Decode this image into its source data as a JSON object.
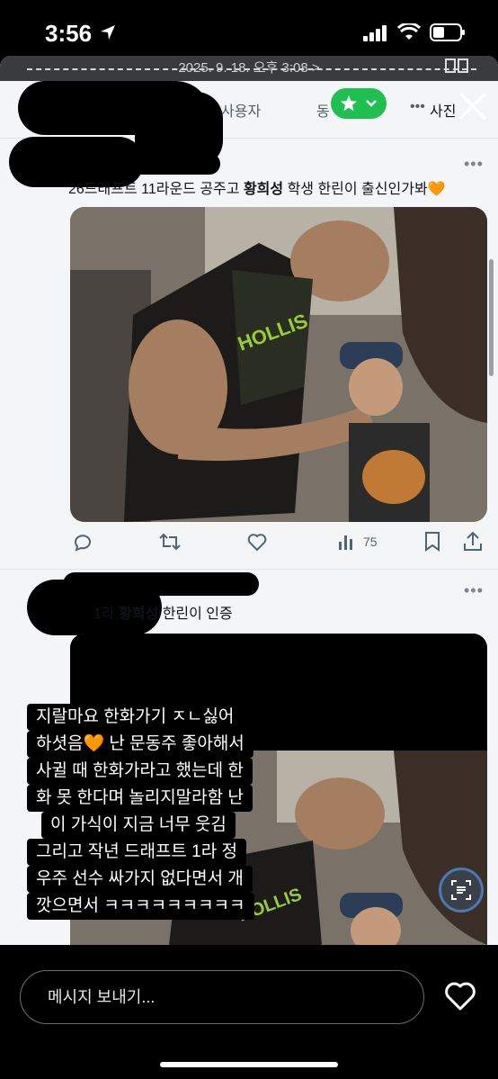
{
  "status_bar": {
    "time": "3:56"
  },
  "story": {
    "date": "2025. 9. 18. 오후 3:08",
    "date_suffix": ">"
  },
  "tabs": [
    {
      "label": "사용자"
    },
    {
      "label": "동"
    },
    {
      "label": "사진"
    }
  ],
  "tweets": [
    {
      "text_prefix": "26드래프트 11라운드 공주고 ",
      "text_bold": "황희성",
      "text_suffix": " 학생 한린이 출신인가봐🧡",
      "more": "•••",
      "views": "75"
    },
    {
      "text_prefix": "1라 ",
      "text_bold": "황희성",
      "text_suffix": " 한린이 인증",
      "more": "•••"
    }
  ],
  "caption_lines": [
    "지랄마요 한화가기 ㅈㄴ싫어",
    "하셧음🧡 난 문동주 좋아해서",
    "사귈 때 한화가라고 했는데 한",
    "화 못 한다며 놀리지말라함 난",
    "이 가식이 지금 너무 웃김",
    "그리고 작년 드래프트 1라 정",
    "우주 선수 싸가지 없다면서 개",
    "깟으면서 ㅋㅋㅋㅋㅋㅋㅋㅋㅋ"
  ],
  "reply_bar": {
    "placeholder": "메시지 보내기..."
  },
  "colors": {
    "accent": "#1d9bf0",
    "star_pill": "#1fbf52"
  }
}
